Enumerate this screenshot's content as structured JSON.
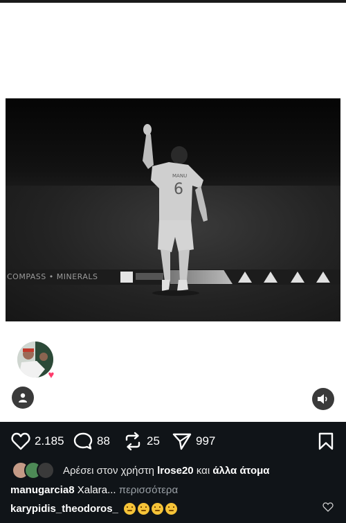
{
  "post": {
    "board_text": "COMPASS • MINERALS",
    "jersey_name": "MANU",
    "jersey_number": "6"
  },
  "actions": {
    "likes": "2.185",
    "comments": "88",
    "reposts": "25",
    "shares": "997"
  },
  "liked_by": {
    "prefix": "Αρέσει στον χρήστη",
    "user": "lrose20",
    "middle": "και",
    "suffix": "άλλα άτομα"
  },
  "caption": {
    "username": "manugarcia8",
    "text": "Xalara...",
    "more": "περισσότερα"
  },
  "comment": {
    "username": "karypidis_theodoros_"
  },
  "colors": {
    "panel_bg": "#101418",
    "heart_badge": "#ff3b6b",
    "emoji": "#f5c338"
  }
}
